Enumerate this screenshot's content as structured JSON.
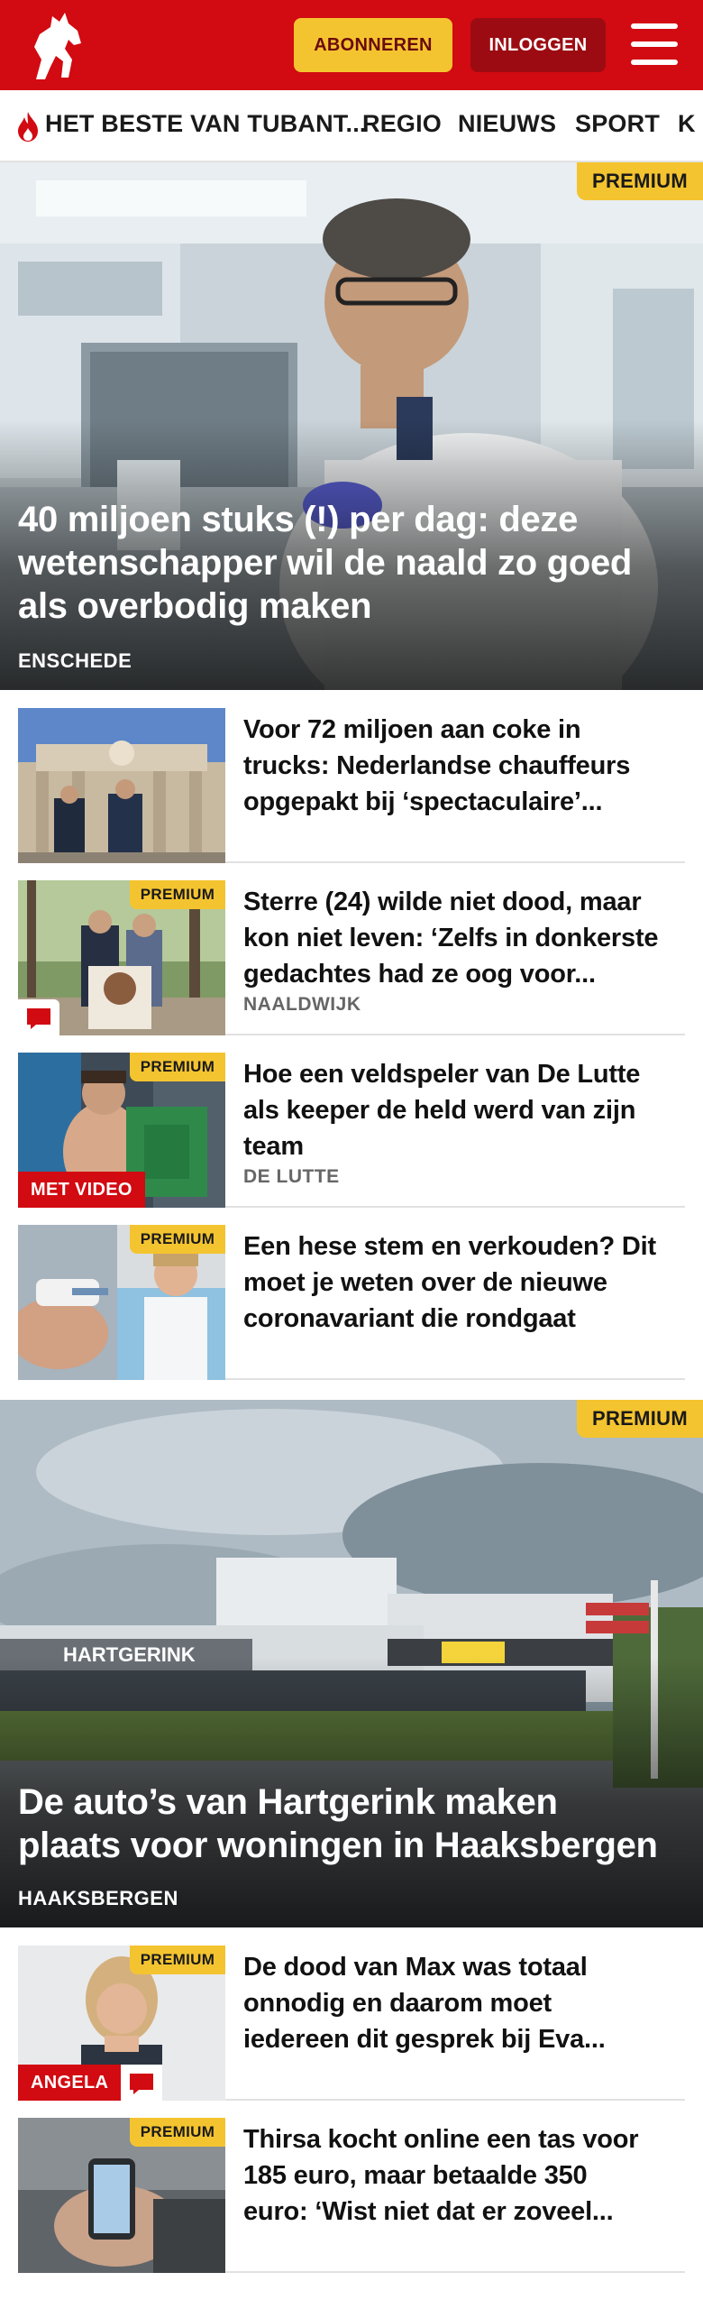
{
  "header": {
    "subscribe_label": "ABONNEREN",
    "login_label": "INLOGGEN",
    "brand_color": "#d20a11",
    "accent_color": "#f4c430"
  },
  "nav": {
    "items": [
      {
        "label": "HET BESTE VAN TUBANT..."
      },
      {
        "label": "REGIO"
      },
      {
        "label": "NIEUWS"
      },
      {
        "label": "SPORT"
      },
      {
        "label": "K"
      }
    ]
  },
  "hero1": {
    "badge": "PREMIUM",
    "title_lines": [
      "40 miljoen stuks (!) per dag: deze",
      "wetenschapper wil de naald zo goed",
      "als overbodig maken"
    ],
    "location": "ENSCHEDE"
  },
  "articles": [
    {
      "title_lines": [
        "Voor 72 miljoen aan coke in",
        "trucks: Nederlandse chauffeurs",
        "opgepakt bij ‘spectaculaire’..."
      ]
    },
    {
      "badge": "PREMIUM",
      "title_lines": [
        "Sterre (24) wilde niet dood, maar",
        "kon niet leven: ‘Zelfs in donkerste",
        "gedachtes had ze oog voor..."
      ],
      "location": "NAALDWIJK",
      "icon": "comment-icon"
    },
    {
      "badge": "PREMIUM",
      "title_lines": [
        "Hoe een veldspeler van De Lutte",
        "als keeper de held werd van zijn",
        "team"
      ],
      "location": "DE LUTTE",
      "video_label": "MET VIDEO"
    },
    {
      "badge": "PREMIUM",
      "title_lines": [
        "Een hese stem en verkouden? Dit",
        "moet je weten over de nieuwe",
        "coronavariant die rondgaat"
      ]
    }
  ],
  "hero2": {
    "badge": "PREMIUM",
    "title_lines": [
      "De auto’s van Hartgerink maken",
      "plaats voor woningen in Haaksbergen"
    ],
    "location": "HAAKSBERGEN",
    "building_sign": "HARTGERINK"
  },
  "articles2": [
    {
      "badge": "PREMIUM",
      "title_lines": [
        "De dood van Max was totaal",
        "onnodig en daarom moet",
        "iedereen dit gesprek bij Eva..."
      ],
      "author_label": "ANGELA",
      "icon": "comment-icon"
    },
    {
      "badge": "PREMIUM",
      "title_lines": [
        "Thirsa kocht online een tas voor",
        "185 euro, maar betaalde 350",
        "euro: ‘Wist niet dat er zoveel..."
      ]
    }
  ]
}
